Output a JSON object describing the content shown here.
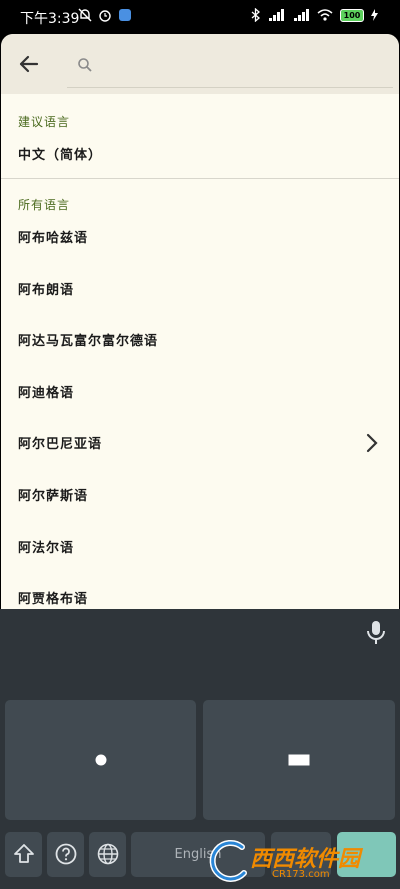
{
  "status_bar": {
    "time": "下午3:39",
    "battery": "100"
  },
  "toolbar": {
    "search_placeholder": ""
  },
  "sections": {
    "suggested_header": "建议语言",
    "suggested_items": [
      "中文（简体）"
    ],
    "all_header": "所有语言",
    "all_items": [
      "阿布哈兹语",
      "阿布朗语",
      "阿达马瓦富尔富尔德语",
      "阿迪格语",
      "阿尔巴尼亚语",
      "阿尔萨斯语",
      "阿法尔语",
      "阿贾格布语"
    ]
  },
  "keyboard": {
    "space_label": "English"
  },
  "watermark": {
    "brand": "西西软件园",
    "url": "CR173.com"
  },
  "colors": {
    "accent": "#4a6a1e",
    "keyboard_bg": "#2f353a",
    "key_bg": "#414a51",
    "enter_key": "#7fc7b8"
  },
  "icons": [
    "back-arrow-icon",
    "search-icon",
    "chevron-right-icon",
    "mic-icon",
    "shift-icon",
    "help-icon",
    "globe-icon"
  ]
}
